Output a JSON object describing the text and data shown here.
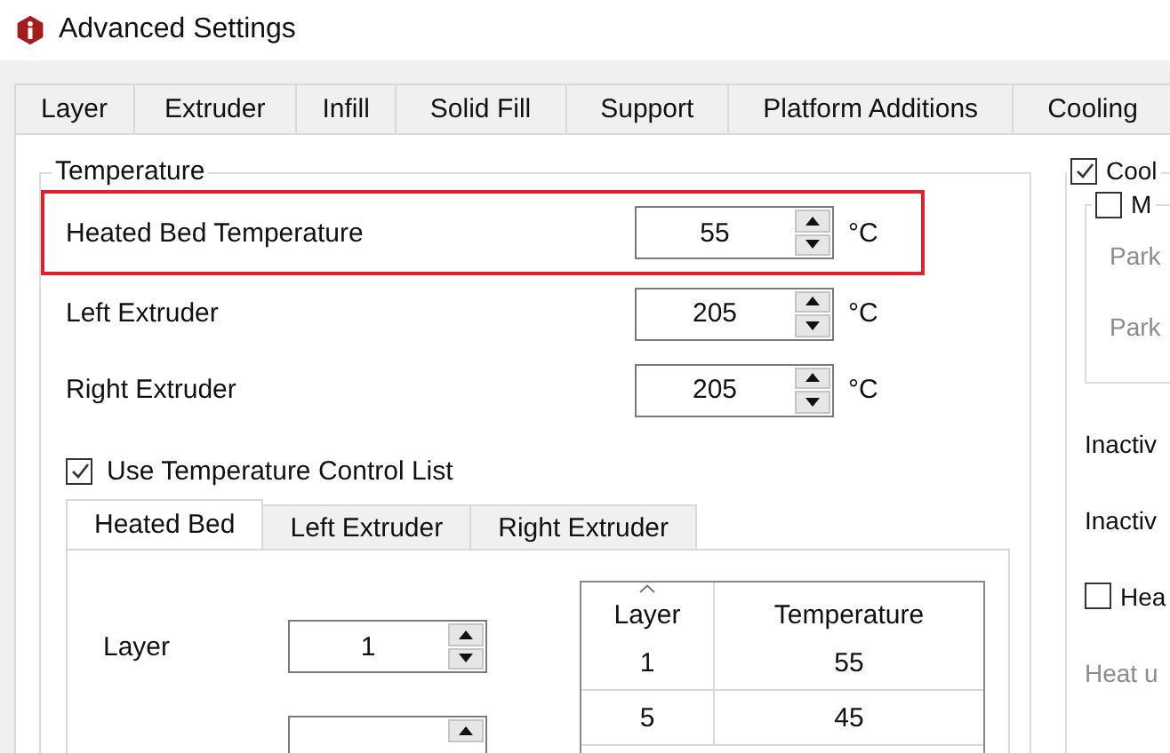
{
  "window": {
    "title": "Advanced Settings"
  },
  "tabs": [
    {
      "label": "Layer",
      "selected": false
    },
    {
      "label": "Extruder",
      "selected": false
    },
    {
      "label": "Infill",
      "selected": false
    },
    {
      "label": "Solid Fill",
      "selected": false
    },
    {
      "label": "Support",
      "selected": false
    },
    {
      "label": "Platform Additions",
      "selected": false
    },
    {
      "label": "Cooling",
      "selected": false
    }
  ],
  "temperature_group": {
    "title": "Temperature",
    "rows": [
      {
        "label": "Heated Bed Temperature",
        "value": "55",
        "unit": "°C",
        "highlighted": true
      },
      {
        "label": "Left Extruder",
        "value": "205",
        "unit": "°C",
        "highlighted": false
      },
      {
        "label": "Right Extruder",
        "value": "205",
        "unit": "°C",
        "highlighted": false
      }
    ],
    "control_list": {
      "label": "Use Temperature Control List",
      "checked": true
    },
    "sub_tabs": [
      {
        "label": "Heated Bed",
        "selected": true
      },
      {
        "label": "Left Extruder",
        "selected": false
      },
      {
        "label": "Right Extruder",
        "selected": false
      }
    ],
    "layer_field": {
      "label": "Layer",
      "value": "1"
    },
    "table": {
      "columns": [
        "Layer",
        "Temperature"
      ],
      "rows": [
        [
          "1",
          "55"
        ],
        [
          "5",
          "45"
        ]
      ]
    }
  },
  "cooling_group": {
    "label": "Cool",
    "checked": true,
    "inner": {
      "label": "M",
      "checked": false,
      "items": [
        {
          "text": "Park",
          "disabled": true
        },
        {
          "text": "Park",
          "disabled": true
        }
      ]
    },
    "items": [
      {
        "kind": "label",
        "text": "Inactiv"
      },
      {
        "kind": "label",
        "text": "Inactiv"
      },
      {
        "kind": "checkbox",
        "text": "Hea",
        "checked": false
      },
      {
        "kind": "hint",
        "text": "Heat u"
      }
    ]
  }
}
